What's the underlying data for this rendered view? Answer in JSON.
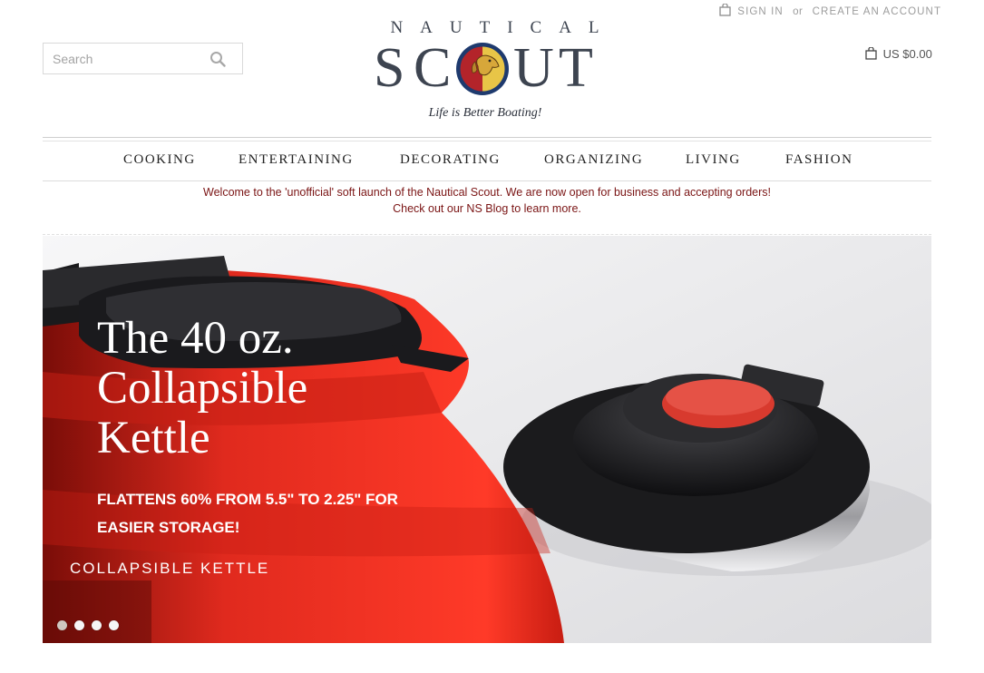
{
  "header": {
    "search_placeholder": "Search",
    "sign_in": "Sign in",
    "or": "or",
    "create_account": "Create an account",
    "cart_total": "US $0.00"
  },
  "logo": {
    "top_word": "NAUTICAL",
    "letters": [
      "S",
      "C",
      "U",
      "T"
    ],
    "tagline": "Life is Better Boating!"
  },
  "nav": {
    "items": [
      "COOKING",
      "ENTERTAINING",
      "DECORATING",
      "ORGANIZING",
      "LIVING",
      "FASHION"
    ]
  },
  "announcement": {
    "line1": "Welcome to the 'unofficial' soft launch of the Nautical Scout.  We are now open for business and accepting orders!",
    "line2": "Check out our NS Blog to learn more."
  },
  "hero": {
    "headline": [
      "The 40 oz.",
      "Collapsible",
      "Kettle"
    ],
    "subtext": [
      "FLATTENS 60% FROM 5.5\" TO 2.25\" FOR",
      "EASIER STORAGE!"
    ],
    "cta": "COLLAPSIBLE KETTLE",
    "slide_count": 4,
    "active_slide": 1
  },
  "colors": {
    "accent_red": "#7a1414",
    "logo_blue": "#3d4450",
    "badge_red": "#b3242a",
    "badge_navy": "#1e3a6e",
    "badge_gold": "#e8c547",
    "kettle_red": "#e8291f"
  },
  "icons": {
    "search": "search-icon",
    "bag": "shopping-bag-icon",
    "badge": "dog-badge-icon"
  }
}
